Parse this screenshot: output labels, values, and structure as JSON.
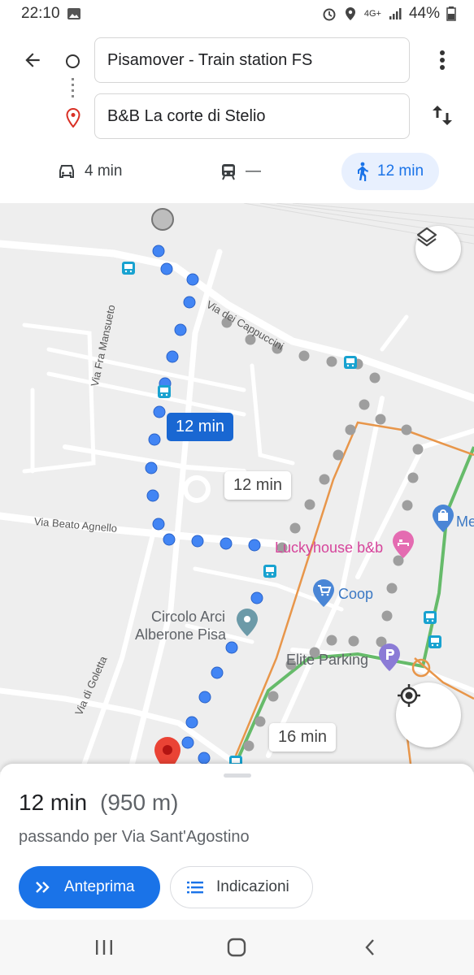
{
  "status_bar": {
    "time": "22:10",
    "network": "4G+",
    "battery": "44%",
    "icons": [
      "image-icon",
      "alarm-icon",
      "location-icon",
      "signal-icon",
      "battery-icon"
    ]
  },
  "search": {
    "origin": "Pisamover - Train station FS",
    "destination": "B&B La corte di Stelio"
  },
  "modes": {
    "car": "4 min",
    "transit": "—",
    "walk": "12 min",
    "selected": "walk"
  },
  "map": {
    "route_labels": {
      "selected": "12 min",
      "alt_1": "12 min",
      "alt_2": "16 min"
    },
    "streets": [
      "Via Fra Mansueto",
      "Via dei Cappuccini",
      "Via Beato Agnello",
      "Via di Goletta"
    ],
    "pois": [
      "Luckyhouse b&b",
      "Coop",
      "Circolo Arci",
      "Alberone Pisa",
      "Elite Parking",
      "Me"
    ],
    "colors": {
      "route": "#4285f4",
      "alt_route": "#9e9e9e",
      "pin": "#ea4335"
    }
  },
  "summary": {
    "time": "12 min",
    "distance": "(950 m)",
    "via": "passando per Via Sant'Agostino"
  },
  "actions": {
    "preview": "Anteprima",
    "directions": "Indicazioni"
  }
}
